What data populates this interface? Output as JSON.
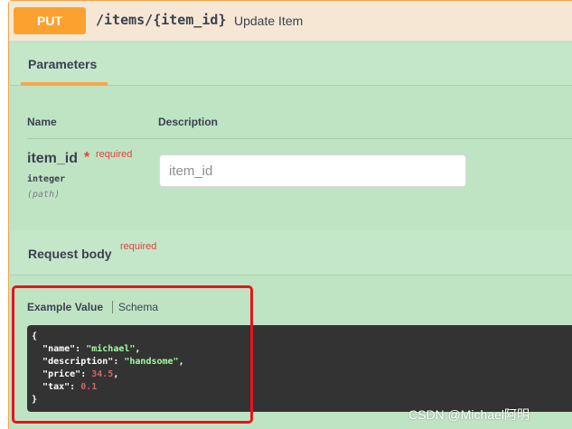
{
  "summary": {
    "method": "PUT",
    "path": "/items/{item_id}",
    "description": "Update Item"
  },
  "parameters": {
    "tab_label": "Parameters",
    "columns": {
      "name": "Name",
      "description": "Description"
    },
    "items": [
      {
        "name": "item_id",
        "star": "*",
        "required_label": "required",
        "type": "integer",
        "in": "(path)",
        "placeholder": "item_id",
        "value": ""
      }
    ]
  },
  "request_body": {
    "title": "Request body",
    "required_label": "required",
    "tabs": {
      "example": "Example Value",
      "schema": "Schema"
    },
    "example": {
      "open": "{",
      "fields": [
        {
          "key": "\"name\"",
          "value": "\"michael\"",
          "kind": "string",
          "comma": ","
        },
        {
          "key": "\"description\"",
          "value": "\"handsome\"",
          "kind": "string",
          "comma": ","
        },
        {
          "key": "\"price\"",
          "value": "34.5",
          "kind": "number",
          "comma": ","
        },
        {
          "key": "\"tax\"",
          "value": "0.1",
          "kind": "number",
          "comma": ""
        }
      ],
      "close": "}"
    }
  },
  "watermark": "CSDN @Michael阿明",
  "colors": {
    "method_put": "#fca130",
    "opblock_bg": "#bfe4c4",
    "opblock_border": "#f0a54a",
    "required": "#e0433e",
    "highlight": "#e8141b",
    "code_bg": "#333333",
    "code_string": "#a2fca2",
    "code_number": "#d36363"
  }
}
